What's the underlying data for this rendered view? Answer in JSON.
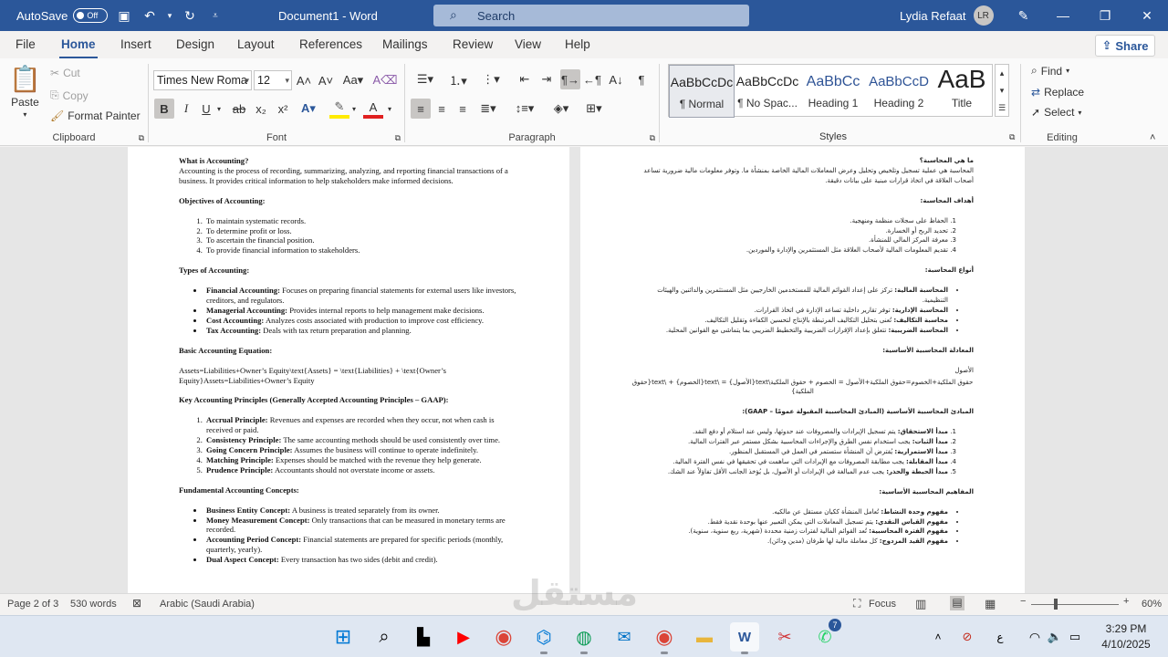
{
  "titlebar": {
    "autosave_label": "AutoSave",
    "autosave_state": "Off",
    "doc_title": "Document1  -  Word",
    "search_placeholder": "Search",
    "user_name": "Lydia Refaat",
    "user_initials": "LR"
  },
  "tabs": [
    "File",
    "Home",
    "Insert",
    "Design",
    "Layout",
    "References",
    "Mailings",
    "Review",
    "View",
    "Help"
  ],
  "active_tab": "Home",
  "share_label": "Share",
  "clipboard": {
    "paste": "Paste",
    "cut": "Cut",
    "copy": "Copy",
    "format_painter": "Format Painter",
    "label": "Clipboard"
  },
  "font": {
    "name": "Times New Roma",
    "size": "12",
    "label": "Font"
  },
  "paragraph": {
    "label": "Paragraph"
  },
  "styles": {
    "label": "Styles",
    "items": [
      {
        "preview": "AaBbCcDc",
        "name": "¶ Normal"
      },
      {
        "preview": "AaBbCcDc",
        "name": "¶ No Spac..."
      },
      {
        "preview": "AaBbCc",
        "name": "Heading 1"
      },
      {
        "preview": "AaBbCcD",
        "name": "Heading 2"
      },
      {
        "preview": "AaB",
        "name": "Title"
      }
    ]
  },
  "editing": {
    "find": "Find",
    "replace": "Replace",
    "select": "Select",
    "label": "Editing"
  },
  "page1": {
    "what_h": "What is Accounting?",
    "what_p": "Accounting is the process of recording, summarizing, analyzing, and reporting financial transactions of a business. It provides critical information to help stakeholders make informed decisions.",
    "obj_h": "Objectives of Accounting:",
    "obj": [
      "To maintain systematic records.",
      "To determine profit or loss.",
      "To ascertain the financial position.",
      "To provide financial information to stakeholders."
    ],
    "types_h": "Types of Accounting:",
    "types": [
      {
        "b": "Financial Accounting:",
        "t": " Focuses on preparing financial statements for external users like investors, creditors, and regulators."
      },
      {
        "b": "Managerial Accounting:",
        "t": " Provides internal reports to help management make decisions."
      },
      {
        "b": "Cost Accounting:",
        "t": " Analyzes costs associated with production to improve cost efficiency."
      },
      {
        "b": "Tax Accounting:",
        "t": " Deals with tax return preparation and planning."
      }
    ],
    "eq_h": "Basic Accounting Equation:",
    "eq_p": "Assets=Liabilities+Owner’s Equity\\text{Assets} = \\text{Liabilities} + \\text{Owner’s Equity}Assets=Liabilities+Owner’s Equity",
    "gaap_h": "Key Accounting Principles (Generally Accepted Accounting Principles – GAAP):",
    "gaap": [
      {
        "b": "Accrual Principle:",
        "t": " Revenues and expenses are recorded when they occur, not when cash is received or paid."
      },
      {
        "b": "Consistency Principle:",
        "t": " The same accounting methods should be used consistently over time."
      },
      {
        "b": "Going Concern Principle:",
        "t": " Assumes the business will continue to operate indefinitely."
      },
      {
        "b": "Matching Principle:",
        "t": " Expenses should be matched with the revenue they help generate."
      },
      {
        "b": "Prudence Principle:",
        "t": " Accountants should not overstate income or assets."
      }
    ],
    "fund_h": "Fundamental Accounting Concepts:",
    "fund": [
      {
        "b": "Business Entity Concept:",
        "t": " A business is treated separately from its owner."
      },
      {
        "b": "Money Measurement Concept:",
        "t": " Only transactions that can be measured in monetary terms are recorded."
      },
      {
        "b": "Accounting Period Concept:",
        "t": " Financial statements are prepared for specific periods (monthly, quarterly, yearly)."
      },
      {
        "b": "Dual Aspect Concept:",
        "t": " Every transaction has two sides (debit and credit)."
      }
    ]
  },
  "page2": {
    "what_h": "ما هي المحاسبة؟",
    "what_p": "المحاسبة هي عملية تسجيل وتلخيص وتحليل وعرض المعاملات المالية الخاصة بمنشأة ما. وتوفر معلومات مالية ضرورية تساعد أصحاب العلاقة في اتخاذ قرارات مبنية على بيانات دقيقة.",
    "obj_h": "أهداف المحاسبة:",
    "obj": [
      "الحفاظ على سجلات منظمة ومنهجية.",
      "تحديد الربح أو الخسارة.",
      "معرفة المركز المالي للمنشأة.",
      "تقديم المعلومات المالية لأصحاب العلاقة مثل المستثمرين والإدارة والموردين."
    ],
    "types_h": "أنواع المحاسبة:",
    "types": [
      {
        "b": "المحاسبة المالية:",
        "t": " تركز على إعداد القوائم المالية للمستخدمين الخارجيين مثل المستثمرين والدائنين والهيئات التنظيمية."
      },
      {
        "b": "المحاسبة الإدارية:",
        "t": " توفر تقارير داخلية تساعد الإدارة في اتخاذ القرارات."
      },
      {
        "b": "محاسبة التكاليف:",
        "t": " تُعنى بتحليل التكاليف المرتبطة بالإنتاج لتحسين الكفاءة وتقليل التكاليف."
      },
      {
        "b": "المحاسبة الضريبية:",
        "t": " تتعلق بإعداد الإقرارات الضريبية والتخطيط الضريبي بما يتماشى مع القوانين المحلية."
      }
    ],
    "eq_h": "المعادلة المحاسبية الأساسية:",
    "eq_1": "الأصول",
    "eq_2": "حقوق الملكية+الخصوم=حقوق الملكية+الأصول = الخصوم + حقوق الملكية\\text{الأصول} = \\text{الخصوم} + \\text{حقوق الملكية}",
    "gaap_h": "المبادئ المحاسبية الأساسية (المبادئ المحاسبية المقبولة عمومًا – GAAP):",
    "gaap": [
      {
        "b": "مبدأ الاستحقاق:",
        "t": " يتم تسجيل الإيرادات والمصروفات عند حدوثها، وليس عند استلام أو دفع النقد."
      },
      {
        "b": "مبدأ الثبات:",
        "t": " يجب استخدام نفس الطرق والإجراءات المحاسبية بشكل مستمر عبر الفترات المالية."
      },
      {
        "b": "مبدأ الاستمرارية:",
        "t": " يُفترض أن المنشأة ستستمر في العمل في المستقبل المنظور."
      },
      {
        "b": "مبدأ المقابلة:",
        "t": " يجب مطابقة المصروفات مع الإيرادات التي ساهمت في تحقيقها في نفس الفترة المالية."
      },
      {
        "b": "مبدأ الحيطة والحذر:",
        "t": " يجب عدم المبالغة في الإيرادات أو الأصول، بل يُؤخذ الجانب الأقل تفاؤلاً عند الشك."
      }
    ],
    "fund_h": "المفاهيم المحاسبية الأساسية:",
    "fund": [
      {
        "b": "مفهوم وحدة النشاط:",
        "t": " تُعامل المنشأة ككيان مستقل عن مالكيه."
      },
      {
        "b": "مفهوم القياس النقدي:",
        "t": " يتم تسجيل المعاملات التي يمكن التعبير عنها بوحدة نقدية فقط."
      },
      {
        "b": "مفهوم الفترة المحاسبية:",
        "t": " تُعد القوائم المالية لفترات زمنية محددة (شهرية، ربع سنوية، سنوية)."
      },
      {
        "b": "مفهوم القيد المزدوج:",
        "t": " كل معاملة مالية لها طرفان (مدين ودائن)."
      }
    ]
  },
  "status": {
    "page": "Page 2 of 3",
    "words": "530 words",
    "language": "Arabic (Saudi Arabia)",
    "focus": "Focus",
    "zoom": "60%"
  },
  "watermark": "مستقل",
  "taskbar": {
    "time": "3:29 PM",
    "date": "4/10/2025",
    "lang": "ع",
    "badge": "7"
  }
}
